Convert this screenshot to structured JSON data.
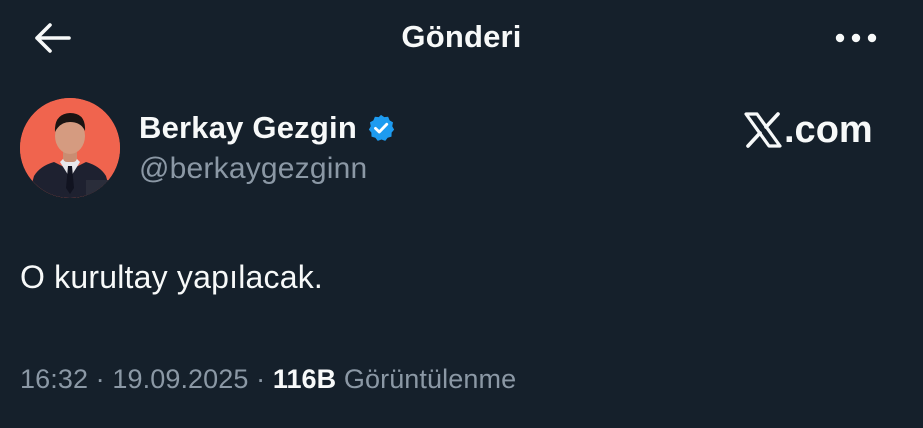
{
  "header": {
    "title": "Gönderi",
    "back_icon": "arrow-left-icon",
    "more_icon": "more-horizontal-icon"
  },
  "author": {
    "display_name": "Berkay Gezgin",
    "handle": "@berkaygezginn",
    "verified": true,
    "verified_color": "#1d9bf0",
    "avatar_background": "#f0644e"
  },
  "watermark": {
    "text": ".com",
    "logo_icon": "x-logo-icon"
  },
  "tweet": {
    "text": "O kurultay yapılacak."
  },
  "meta": {
    "time": "16:32",
    "separator": " · ",
    "date": "19.09.2025",
    "views_count": "116B",
    "views_label": " Görüntülenme"
  },
  "colors": {
    "background": "#15202b",
    "primary_text": "#f7f9f9",
    "secondary_text": "#8b98a5"
  }
}
